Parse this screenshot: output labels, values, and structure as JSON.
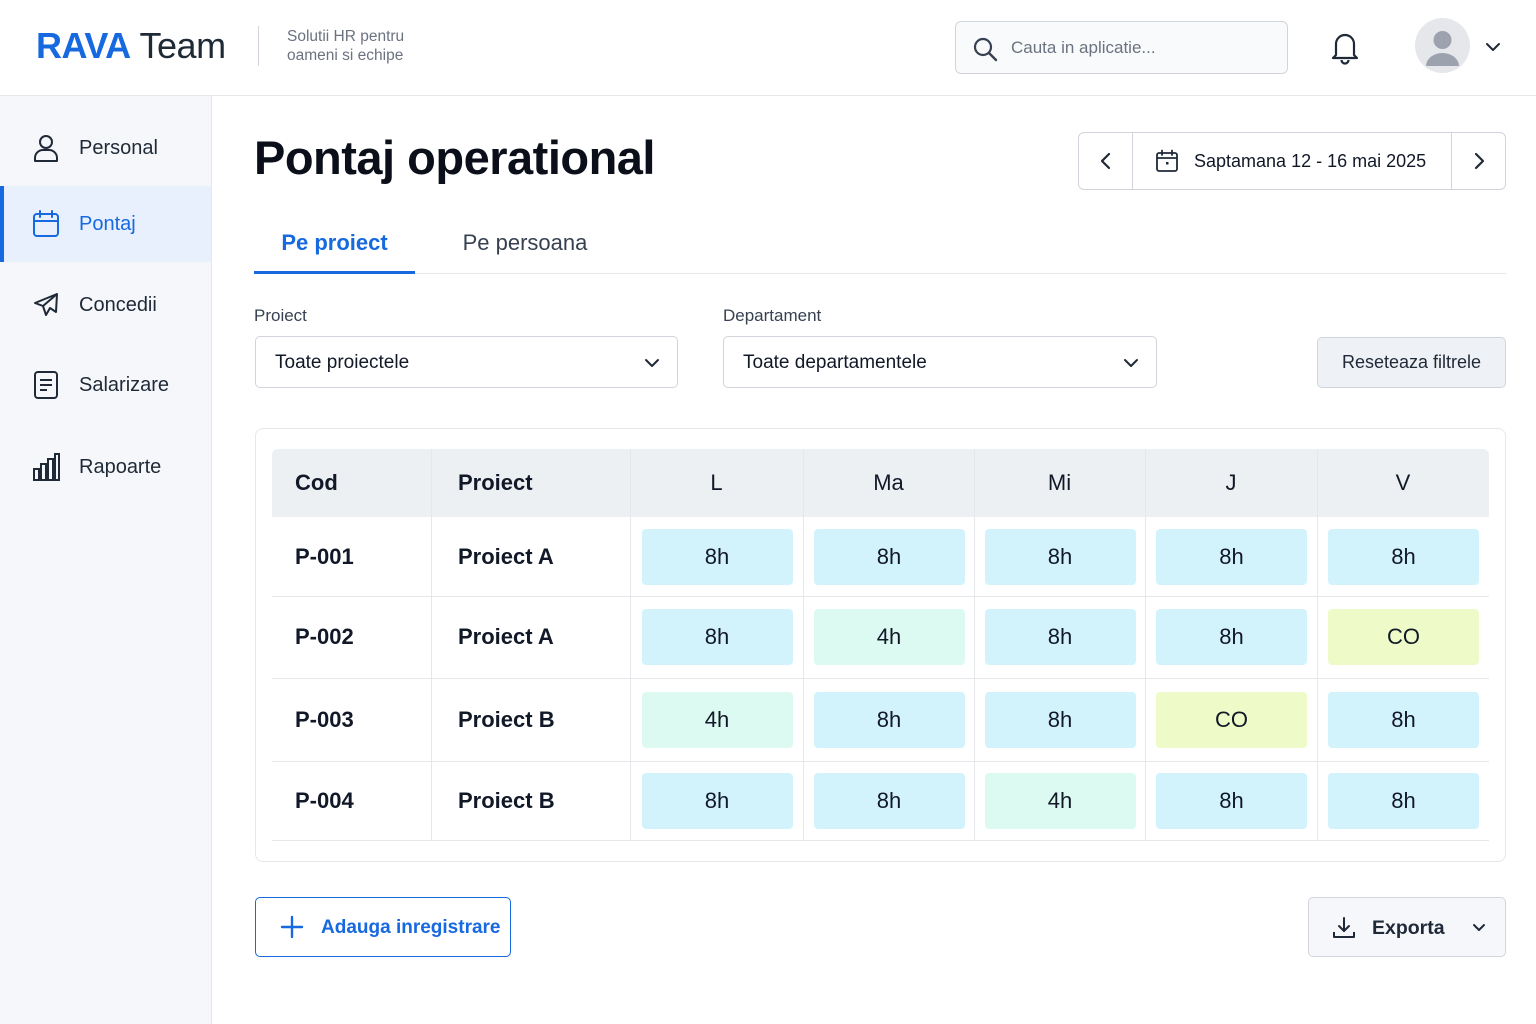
{
  "header": {
    "brand_bold": "RAVA",
    "brand_rest": " Team",
    "tagline": "Solutii HR pentru oameni si echipe",
    "search_placeholder": "Cauta in aplicatie..."
  },
  "sidebar": {
    "items": [
      {
        "label": "Personal",
        "icon": "user-icon",
        "active": false
      },
      {
        "label": "Pontaj",
        "icon": "calendar-icon",
        "active": true
      },
      {
        "label": "Concedii",
        "icon": "plane-icon",
        "active": false
      },
      {
        "label": "Salarizare",
        "icon": "document-icon",
        "active": false
      },
      {
        "label": "Rapoarte",
        "icon": "bar-chart-icon",
        "active": false
      }
    ]
  },
  "main": {
    "title": "Pontaj operational",
    "week": "Saptamana 12 - 16 mai 2025",
    "tabs": [
      {
        "label": "Pe proiect",
        "active": true
      },
      {
        "label": "Pe persoana",
        "active": false
      }
    ],
    "filters": {
      "project": {
        "label": "Proiect",
        "value": "Toate proiectele"
      },
      "department": {
        "label": "Departament",
        "value": "Toate departamentele"
      },
      "reset_label": "Reseteaza filtrele"
    },
    "table": {
      "columns": [
        "Cod",
        "Proiect",
        "L",
        "Ma",
        "Mi",
        "J",
        "V"
      ],
      "rows": [
        {
          "code": "P-001",
          "project": "Proiect A",
          "days": [
            "8h",
            "8h",
            "8h",
            "8h",
            "8h"
          ]
        },
        {
          "code": "P-002",
          "project": "Proiect A",
          "days": [
            "8h",
            "4h",
            "8h",
            "8h",
            "CO"
          ]
        },
        {
          "code": "P-003",
          "project": "Proiect B",
          "days": [
            "4h",
            "8h",
            "8h",
            "CO",
            "8h"
          ]
        },
        {
          "code": "P-004",
          "project": "Proiect B",
          "days": [
            "8h",
            "8h",
            "4h",
            "8h",
            "8h"
          ]
        }
      ]
    },
    "add_label": "Adauga inregistrare",
    "export_label": "Exporta"
  },
  "colors": {
    "accent": "#1769e0",
    "full_day": "#d3f3fc",
    "half_day": "#dcfaf2",
    "leave": "#eefbc9"
  }
}
